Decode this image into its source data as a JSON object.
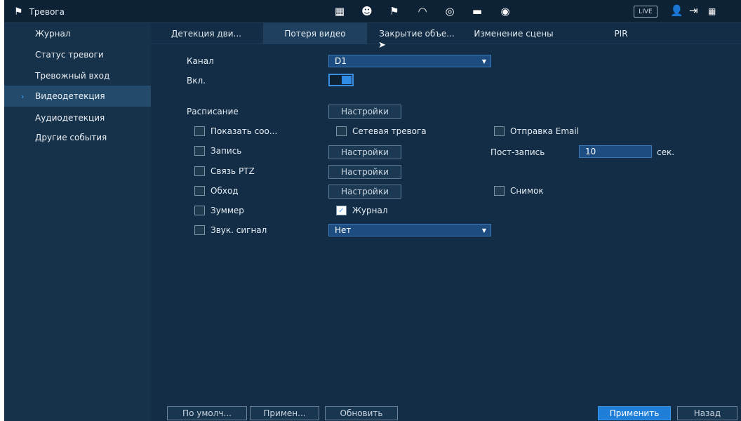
{
  "header": {
    "title": "Тревога",
    "live_label": "LIVE"
  },
  "sidebar": {
    "items": [
      {
        "label": "Журнал"
      },
      {
        "label": "Статус тревоги"
      },
      {
        "label": "Тревожный вход"
      },
      {
        "label": "Видеодетекция"
      },
      {
        "label": "Аудиодетекция"
      },
      {
        "label": "Другие события"
      }
    ]
  },
  "tabs": [
    {
      "label": "Детекция дви..."
    },
    {
      "label": "Потеря видео"
    },
    {
      "label": "Закрытие объе..."
    },
    {
      "label": "Изменение сцены"
    },
    {
      "label": "PIR"
    }
  ],
  "form": {
    "channel_label": "Канал",
    "channel_value": "D1",
    "enable_label": "Вкл.",
    "enable_on": true,
    "schedule_label": "Расписание",
    "settings_label": "Настройки",
    "show_message_label": "Показать соо...",
    "network_alarm_label": "Сетевая тревога",
    "send_email_label": "Отправка Email",
    "record_label": "Запись",
    "post_record_label": "Пост-запись",
    "post_record_value": "10",
    "post_record_unit": "сек.",
    "ptz_label": "Связь PTZ",
    "tour_label": "Обход",
    "snapshot_label": "Снимок",
    "buzzer_label": "Зуммер",
    "log_label": "Журнал",
    "log_checked": true,
    "sound_label": "Звук. сигнал",
    "sound_value": "Нет"
  },
  "footer": {
    "default_label": "По умолч...",
    "apply_short_label": "Примен...",
    "refresh_label": "Обновить",
    "apply_label": "Применить",
    "back_label": "Назад"
  },
  "colors": {
    "background": "#16314a",
    "panel": "#122d45",
    "accent": "#1f7fd8",
    "field": "#1d4d80"
  }
}
